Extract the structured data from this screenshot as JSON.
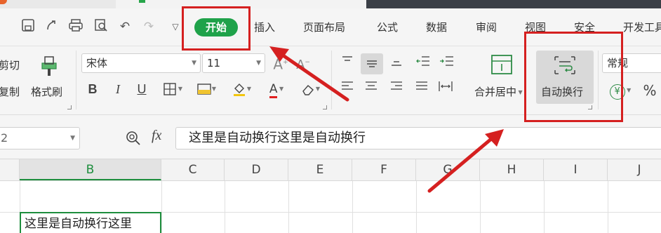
{
  "tabs": [
    "开始",
    "插入",
    "页面布局",
    "公式",
    "数据",
    "审阅",
    "视图",
    "安全",
    "开发工具"
  ],
  "ribbon": {
    "cut_label": "剪切",
    "copy_label": "复制",
    "format_painter_label": "格式刷",
    "font_name": "宋体",
    "font_size": "11",
    "merge_center_label": "合并居中",
    "wrap_text_label": "自动换行",
    "number_format": "常规",
    "bold_glyph": "B",
    "italic_glyph": "I",
    "underline_glyph": "U",
    "percent_glyph": "%",
    "currency_glyph": "¥"
  },
  "formula_bar": {
    "name_box_value": "2",
    "fx_label": "fx",
    "content": "这里是自动换行这里是自动换行"
  },
  "grid": {
    "columns": [
      "B",
      "C",
      "D",
      "E",
      "F",
      "G",
      "H",
      "I",
      "J"
    ],
    "active_column": "B",
    "active_cell_text": "这里是自动换行这里"
  },
  "colors": {
    "accent_green": "#1fa24a",
    "annotation_red": "#d52020"
  }
}
